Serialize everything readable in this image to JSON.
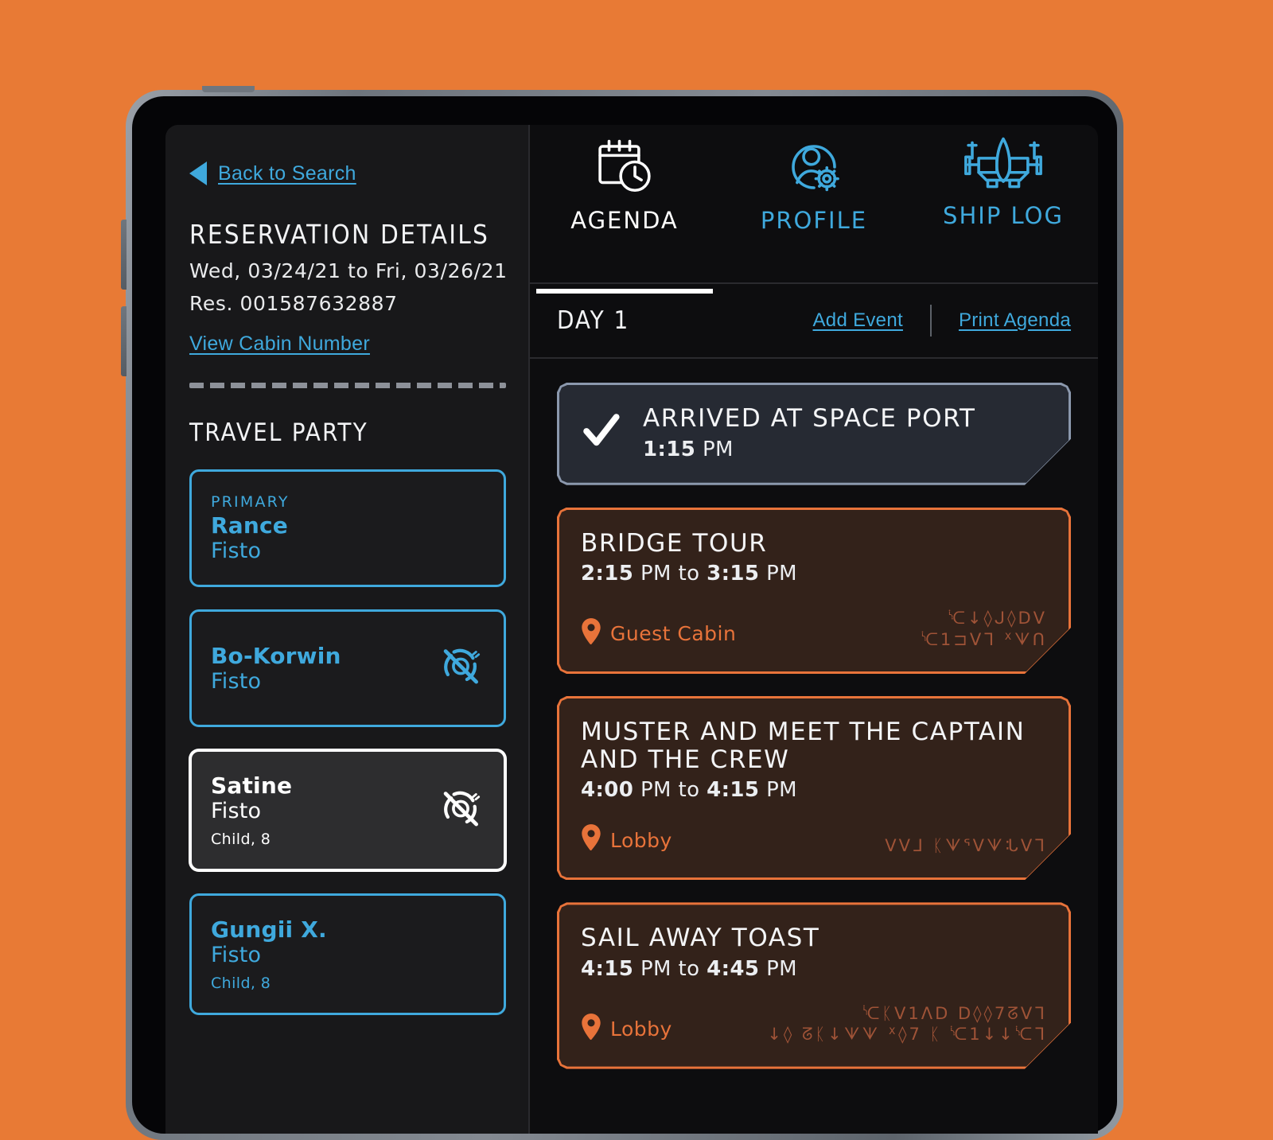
{
  "theme": {
    "page_background": "#e87a35",
    "accent_blue": "#3fa9dd",
    "accent_orange": "#e8733a",
    "panel_dark": "#0d0d0f",
    "sidebar_dark": "#18181a",
    "selected_border": "#ffffff"
  },
  "sidebar": {
    "back_link": "Back to Search",
    "back_icon": "triangle-left-icon",
    "heading": "RESERVATION DETAILS",
    "dates": "Wed, 03/24/21 to Fri, 03/26/21",
    "reservation_number": "Res. 001587632887",
    "cabin_link": "View Cabin Number",
    "travel_party_heading": "TRAVEL PARTY",
    "party": [
      {
        "role": "PRIMARY",
        "first_name": "Rance",
        "last_name": "Fisto",
        "meta": "",
        "selected": false,
        "band_disabled": false
      },
      {
        "role": "",
        "first_name": "Bo-Korwin",
        "last_name": "Fisto",
        "meta": "",
        "selected": false,
        "band_disabled": true
      },
      {
        "role": "",
        "first_name": "Satine",
        "last_name": "Fisto",
        "meta": "Child, 8",
        "selected": true,
        "band_disabled": true
      },
      {
        "role": "",
        "first_name": "Gungii X.",
        "last_name": "Fisto",
        "meta": "Child, 8",
        "selected": false,
        "band_disabled": false
      }
    ]
  },
  "main": {
    "tabs": [
      {
        "label": "AGENDA",
        "icon": "calendar-clock-icon",
        "active": true
      },
      {
        "label": "PROFILE",
        "icon": "user-gear-icon",
        "active": false
      },
      {
        "label": "SHIP LOG",
        "icon": "starship-icon",
        "active": false
      }
    ],
    "day_label": "DAY 1",
    "add_event_label": "Add Event",
    "print_agenda_label": "Print Agenda",
    "events": [
      {
        "status": "done",
        "title": "ARRIVED AT SPACE PORT",
        "time_start": "1:15",
        "time_start_suffix": "PM",
        "time_sep": "",
        "time_end": "",
        "time_end_suffix": "",
        "location": "",
        "aurebesh": "",
        "check_icon": "checkmark-icon"
      },
      {
        "status": "upcoming",
        "title": "BRIDGE TOUR",
        "time_start": "2:15",
        "time_start_suffix": "PM",
        "time_sep": "to",
        "time_end": "3:15",
        "time_end_suffix": "PM",
        "location": "Guest Cabin",
        "location_icon": "map-pin-icon",
        "aurebesh": "ᔍ↓◊ᒍ◊ᗞᐯ\nᔍ1⊐ᐯᒣ ᕁᗐᑎ"
      },
      {
        "status": "upcoming",
        "title": "MUSTER AND MEET THE CAPTAIN AND THE CREW",
        "time_start": "4:00",
        "time_start_suffix": "PM",
        "time_sep": "to",
        "time_end": "4:15",
        "time_end_suffix": "PM",
        "location": "Lobby",
        "location_icon": "map-pin-icon",
        "aurebesh": "ᐯᐯᒧ ᛕᗐᕐᐯᗐᒠᐯᒣ"
      },
      {
        "status": "upcoming",
        "title": "SAIL AWAY TOAST",
        "time_start": "4:15",
        "time_start_suffix": "PM",
        "time_sep": "to",
        "time_end": "4:45",
        "time_end_suffix": "PM",
        "location": "Lobby",
        "location_icon": "map-pin-icon",
        "aurebesh": "ᔍᛕᐯ1ᐱᗞ ᗞ◊◊7ᘔᐯᒣ\n↓◊ ᘔᛕ↓ᗐᗐ ᕁ◊7 ᛕ ᔍ1↓↓ᔍᒣ"
      }
    ]
  }
}
